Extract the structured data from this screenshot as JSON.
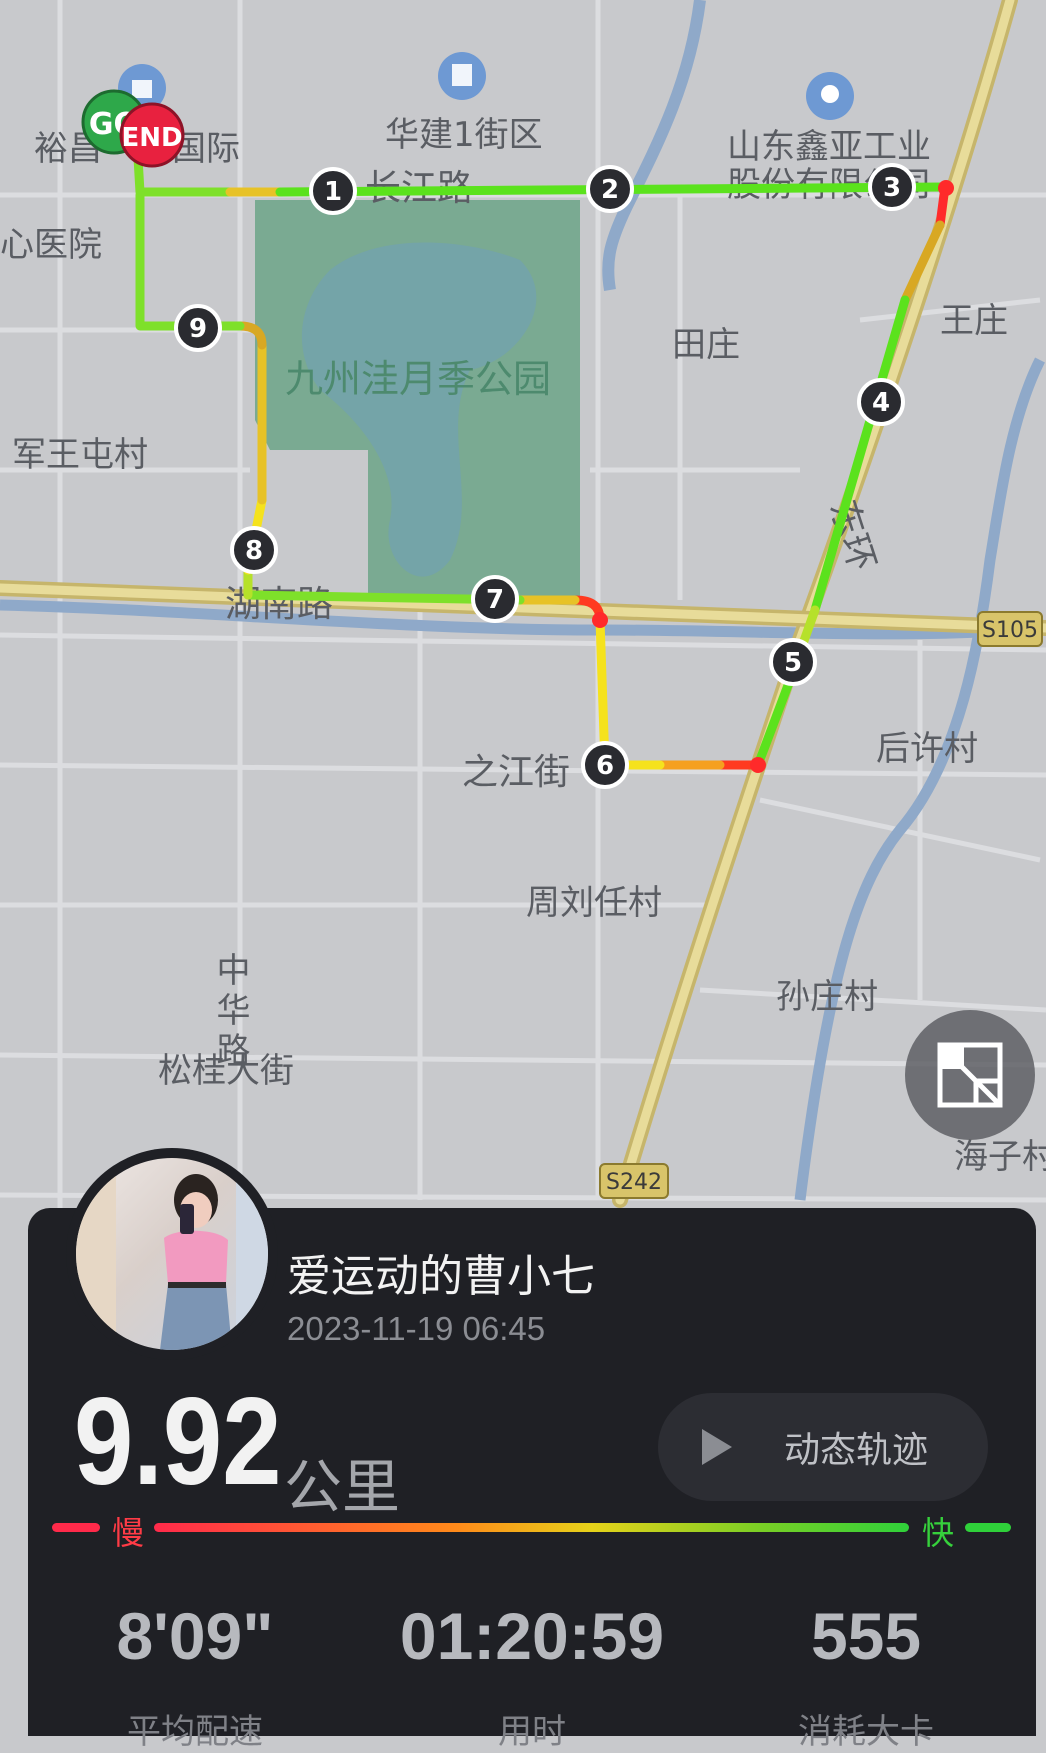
{
  "map": {
    "labels": {
      "yuchang": "裕昌",
      "yuchang_intl": "国际",
      "huajian": "华建1街区",
      "shandong_xinya_1": "山东鑫亚工业",
      "shandong_xinya_2": "股份有限公司",
      "changjiang_road": "长江路",
      "hospital": "心医院",
      "park": "九州洼月季公园",
      "tianzhuang": "田庄",
      "wangzhuang": "王庄",
      "junwangtun": "军王屯村",
      "hunan_road": "湖南路",
      "east_ring": "东环",
      "houxu": "后许村",
      "zhijiang": "之江街",
      "zhouliuren": "周刘任村",
      "sunzhuang": "孙庄村",
      "zhonghua_road": "中华路",
      "songgui": "松桂大街",
      "haizi": "海子村",
      "s105": "S105",
      "s242": "S242"
    },
    "start_marker": "GO",
    "end_marker": "END",
    "km_markers": [
      "1",
      "2",
      "3",
      "4",
      "5",
      "6",
      "7",
      "8",
      "9"
    ]
  },
  "fullscreen_icon": "expand-icon",
  "user": {
    "name": "爱运动的曹小七",
    "time": "2023-11-19 06:45"
  },
  "distance": {
    "value": "9.92",
    "unit": "公里"
  },
  "replay_button": {
    "label": "动态轨迹",
    "icon": "play-icon"
  },
  "speed_legend": {
    "slow": "慢",
    "fast": "快",
    "slow_color": "#ff3b46",
    "fast_color": "#2fd13a"
  },
  "stats": [
    {
      "value": "8'09\"",
      "label": "平均配速"
    },
    {
      "value": "01:20:59",
      "label": "用时"
    },
    {
      "value": "555",
      "label": "消耗大卡"
    }
  ],
  "colors": {
    "panel_bg": "#1f2025",
    "route_fast": "#5be21d",
    "route_slow": "#ff2a2a",
    "park": "#7aaa92"
  }
}
